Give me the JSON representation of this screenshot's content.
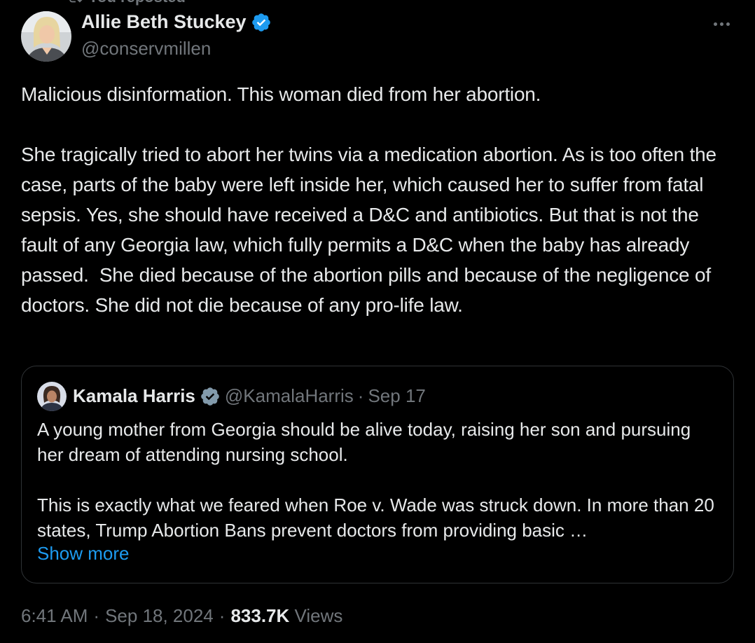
{
  "repost_banner": {
    "text": "You reposted"
  },
  "author": {
    "name": "Allie Beth Stuckey",
    "handle": "@conservmillen",
    "verified": true
  },
  "tweet": {
    "text": "Malicious disinformation. This woman died from her abortion.\n\nShe tragically tried to abort her twins via a medication abortion. As is too often the case, parts of the baby were left inside her, which caused her to suffer from fatal sepsis. Yes, she should have received a D&C and antibiotics. But that is not the fault of any Georgia law, which fully permits a D&C when the baby has already passed.  She died because of the abortion pills and because of the negligence of doctors. She did not die because of any pro-life law."
  },
  "quoted_tweet": {
    "name": "Kamala Harris",
    "handle": "@KamalaHarris",
    "separator": "·",
    "date": "Sep 17",
    "verified": true,
    "text": "A young mother from Georgia should be alive today, raising her son and pursuing her dream of attending nursing school.\n\nThis is exactly what we feared when Roe v. Wade was struck down. In more than 20 states, Trump Abortion Bans prevent doctors from providing basic …",
    "show_more_label": "Show more"
  },
  "meta": {
    "time": "6:41 AM",
    "sep1": "·",
    "date": "Sep 18, 2024",
    "sep2": "·",
    "views_count": "833.7K",
    "views_label": "Views"
  },
  "colors": {
    "background": "#000000",
    "primary_text": "#e7e9ea",
    "secondary_text": "#71767b",
    "accent": "#1d9bf0",
    "border": "#2f3336"
  },
  "icons": {
    "verified": "verified-badge-icon",
    "more": "more-horizontal-icon",
    "repost": "repost-icon"
  }
}
